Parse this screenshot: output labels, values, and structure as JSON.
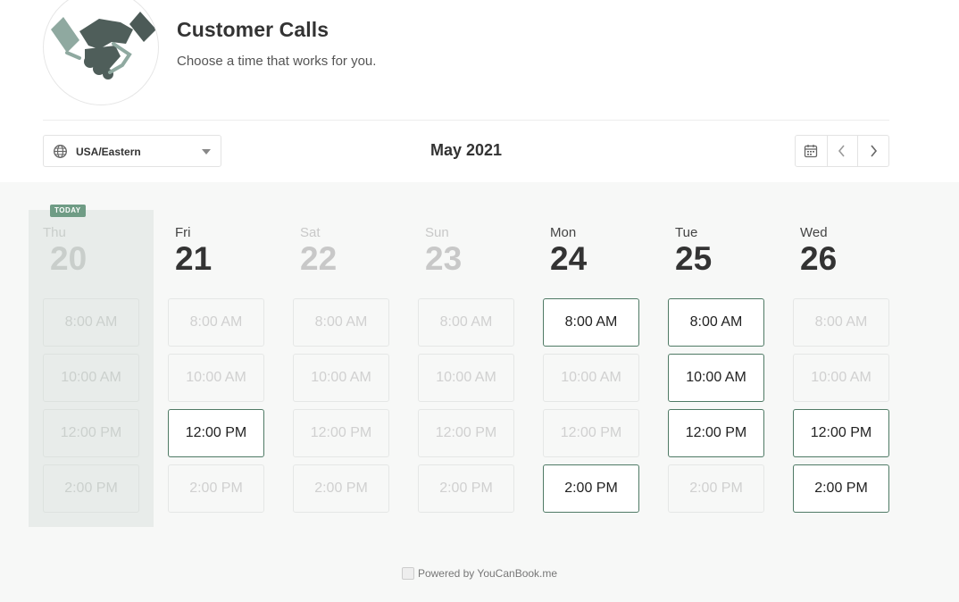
{
  "header": {
    "title": "Customer Calls",
    "subtitle": "Choose a time that works for you."
  },
  "timezone": {
    "value": "USA/Eastern"
  },
  "month_label": "May 2021",
  "icons": {
    "logo": "handshake-icon",
    "timezone": "globe-icon",
    "timezone_caret": "caret-down-icon",
    "calendar": "calendar-icon",
    "prev": "chevron-left-icon",
    "next": "chevron-right-icon",
    "footer": "youcanbook-me-icon"
  },
  "colors": {
    "accent": "#6f9c85",
    "available_border": "#4f7a65",
    "background": "#f7f8f7",
    "today_column": "#e8ecea"
  },
  "today_badge": "TODAY",
  "days": [
    {
      "name": "Thu",
      "num": "20",
      "state": "today",
      "slots": [
        {
          "time": "8:00 AM",
          "available": false
        },
        {
          "time": "10:00 AM",
          "available": false
        },
        {
          "time": "12:00 PM",
          "available": false
        },
        {
          "time": "2:00 PM",
          "available": false
        }
      ]
    },
    {
      "name": "Fri",
      "num": "21",
      "state": "normal",
      "slots": [
        {
          "time": "8:00 AM",
          "available": false
        },
        {
          "time": "10:00 AM",
          "available": false
        },
        {
          "time": "12:00 PM",
          "available": true
        },
        {
          "time": "2:00 PM",
          "available": false
        }
      ]
    },
    {
      "name": "Sat",
      "num": "22",
      "state": "muted",
      "slots": [
        {
          "time": "8:00 AM",
          "available": false
        },
        {
          "time": "10:00 AM",
          "available": false
        },
        {
          "time": "12:00 PM",
          "available": false
        },
        {
          "time": "2:00 PM",
          "available": false
        }
      ]
    },
    {
      "name": "Sun",
      "num": "23",
      "state": "muted",
      "slots": [
        {
          "time": "8:00 AM",
          "available": false
        },
        {
          "time": "10:00 AM",
          "available": false
        },
        {
          "time": "12:00 PM",
          "available": false
        },
        {
          "time": "2:00 PM",
          "available": false
        }
      ]
    },
    {
      "name": "Mon",
      "num": "24",
      "state": "normal",
      "slots": [
        {
          "time": "8:00 AM",
          "available": true
        },
        {
          "time": "10:00 AM",
          "available": false
        },
        {
          "time": "12:00 PM",
          "available": false
        },
        {
          "time": "2:00 PM",
          "available": true
        }
      ]
    },
    {
      "name": "Tue",
      "num": "25",
      "state": "normal",
      "slots": [
        {
          "time": "8:00 AM",
          "available": true
        },
        {
          "time": "10:00 AM",
          "available": true
        },
        {
          "time": "12:00 PM",
          "available": true
        },
        {
          "time": "2:00 PM",
          "available": false
        }
      ]
    },
    {
      "name": "Wed",
      "num": "26",
      "state": "normal",
      "slots": [
        {
          "time": "8:00 AM",
          "available": false
        },
        {
          "time": "10:00 AM",
          "available": false
        },
        {
          "time": "12:00 PM",
          "available": true
        },
        {
          "time": "2:00 PM",
          "available": true
        }
      ]
    }
  ],
  "footer": {
    "text": "Powered by YouCanBook.me"
  }
}
